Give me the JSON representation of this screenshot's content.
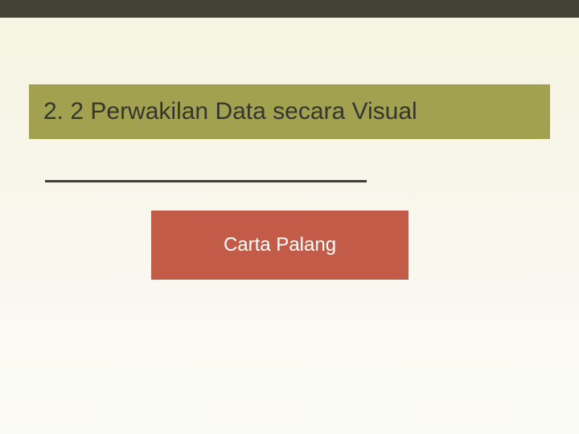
{
  "slide": {
    "section_title": "2. 2  Perwakilan Data secara Visual",
    "subtitle": "Carta Palang"
  }
}
